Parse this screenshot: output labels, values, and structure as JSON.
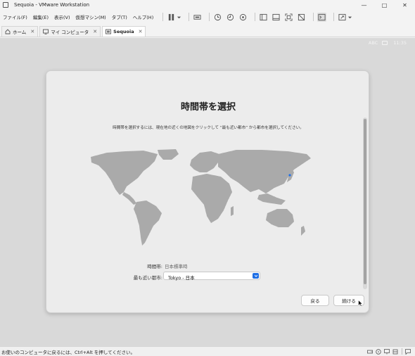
{
  "window": {
    "title": "Sequoia - VMware Workstation"
  },
  "menu": {
    "items": [
      "ファイル(F)",
      "編集(E)",
      "表示(V)",
      "仮想マシン(M)",
      "タブ(T)",
      "ヘルプ(H)"
    ]
  },
  "tabs": [
    {
      "label": "ホーム",
      "icon": "home-icon",
      "active": false
    },
    {
      "label": "マイ コンピュータ",
      "icon": "monitor-icon",
      "active": false
    },
    {
      "label": "Sequoia",
      "icon": "vm-icon",
      "active": true
    }
  ],
  "vm_status": {
    "input": "ABC",
    "time": "11:35"
  },
  "dialog": {
    "title": "時間帯を選択",
    "description": "時間帯を選択するには、現在地の近くの地図をクリックして “最も近い都市” から都市を選択してください。",
    "timezone_label": "時間帯:",
    "timezone_value": "日本標準時",
    "city_label": "最も近い都市:",
    "city_value": "Tokyo - 日本",
    "back_button": "戻る",
    "continue_button": "続ける"
  },
  "statusbar": {
    "text": "お使いのコンピュータに戻るには、Ctrl+Alt を押してください。"
  },
  "colors": {
    "accent": "#1f6fe5",
    "vm_bg": "#d9d9d9",
    "map_land": "#a8a8a8"
  }
}
